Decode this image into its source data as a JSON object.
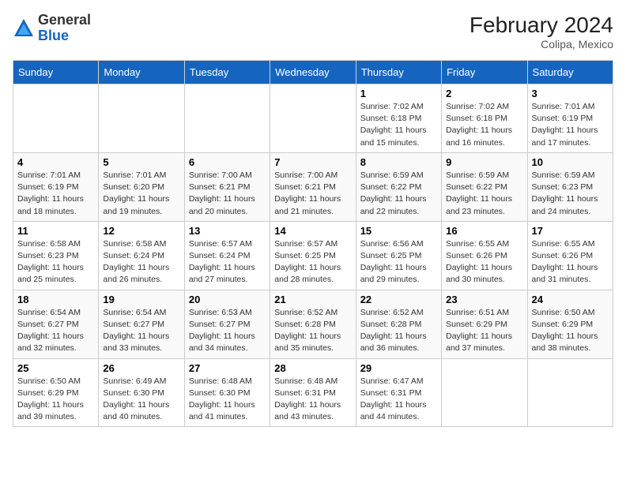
{
  "header": {
    "logo": {
      "general": "General",
      "blue": "Blue"
    },
    "title": "February 2024",
    "location": "Colipa, Mexico"
  },
  "weekdays": [
    "Sunday",
    "Monday",
    "Tuesday",
    "Wednesday",
    "Thursday",
    "Friday",
    "Saturday"
  ],
  "weeks": [
    [
      {
        "day": "",
        "info": ""
      },
      {
        "day": "",
        "info": ""
      },
      {
        "day": "",
        "info": ""
      },
      {
        "day": "",
        "info": ""
      },
      {
        "day": "1",
        "info": "Sunrise: 7:02 AM\nSunset: 6:18 PM\nDaylight: 11 hours and 15 minutes."
      },
      {
        "day": "2",
        "info": "Sunrise: 7:02 AM\nSunset: 6:18 PM\nDaylight: 11 hours and 16 minutes."
      },
      {
        "day": "3",
        "info": "Sunrise: 7:01 AM\nSunset: 6:19 PM\nDaylight: 11 hours and 17 minutes."
      }
    ],
    [
      {
        "day": "4",
        "info": "Sunrise: 7:01 AM\nSunset: 6:19 PM\nDaylight: 11 hours and 18 minutes."
      },
      {
        "day": "5",
        "info": "Sunrise: 7:01 AM\nSunset: 6:20 PM\nDaylight: 11 hours and 19 minutes."
      },
      {
        "day": "6",
        "info": "Sunrise: 7:00 AM\nSunset: 6:21 PM\nDaylight: 11 hours and 20 minutes."
      },
      {
        "day": "7",
        "info": "Sunrise: 7:00 AM\nSunset: 6:21 PM\nDaylight: 11 hours and 21 minutes."
      },
      {
        "day": "8",
        "info": "Sunrise: 6:59 AM\nSunset: 6:22 PM\nDaylight: 11 hours and 22 minutes."
      },
      {
        "day": "9",
        "info": "Sunrise: 6:59 AM\nSunset: 6:22 PM\nDaylight: 11 hours and 23 minutes."
      },
      {
        "day": "10",
        "info": "Sunrise: 6:59 AM\nSunset: 6:23 PM\nDaylight: 11 hours and 24 minutes."
      }
    ],
    [
      {
        "day": "11",
        "info": "Sunrise: 6:58 AM\nSunset: 6:23 PM\nDaylight: 11 hours and 25 minutes."
      },
      {
        "day": "12",
        "info": "Sunrise: 6:58 AM\nSunset: 6:24 PM\nDaylight: 11 hours and 26 minutes."
      },
      {
        "day": "13",
        "info": "Sunrise: 6:57 AM\nSunset: 6:24 PM\nDaylight: 11 hours and 27 minutes."
      },
      {
        "day": "14",
        "info": "Sunrise: 6:57 AM\nSunset: 6:25 PM\nDaylight: 11 hours and 28 minutes."
      },
      {
        "day": "15",
        "info": "Sunrise: 6:56 AM\nSunset: 6:25 PM\nDaylight: 11 hours and 29 minutes."
      },
      {
        "day": "16",
        "info": "Sunrise: 6:55 AM\nSunset: 6:26 PM\nDaylight: 11 hours and 30 minutes."
      },
      {
        "day": "17",
        "info": "Sunrise: 6:55 AM\nSunset: 6:26 PM\nDaylight: 11 hours and 31 minutes."
      }
    ],
    [
      {
        "day": "18",
        "info": "Sunrise: 6:54 AM\nSunset: 6:27 PM\nDaylight: 11 hours and 32 minutes."
      },
      {
        "day": "19",
        "info": "Sunrise: 6:54 AM\nSunset: 6:27 PM\nDaylight: 11 hours and 33 minutes."
      },
      {
        "day": "20",
        "info": "Sunrise: 6:53 AM\nSunset: 6:27 PM\nDaylight: 11 hours and 34 minutes."
      },
      {
        "day": "21",
        "info": "Sunrise: 6:52 AM\nSunset: 6:28 PM\nDaylight: 11 hours and 35 minutes."
      },
      {
        "day": "22",
        "info": "Sunrise: 6:52 AM\nSunset: 6:28 PM\nDaylight: 11 hours and 36 minutes."
      },
      {
        "day": "23",
        "info": "Sunrise: 6:51 AM\nSunset: 6:29 PM\nDaylight: 11 hours and 37 minutes."
      },
      {
        "day": "24",
        "info": "Sunrise: 6:50 AM\nSunset: 6:29 PM\nDaylight: 11 hours and 38 minutes."
      }
    ],
    [
      {
        "day": "25",
        "info": "Sunrise: 6:50 AM\nSunset: 6:29 PM\nDaylight: 11 hours and 39 minutes."
      },
      {
        "day": "26",
        "info": "Sunrise: 6:49 AM\nSunset: 6:30 PM\nDaylight: 11 hours and 40 minutes."
      },
      {
        "day": "27",
        "info": "Sunrise: 6:48 AM\nSunset: 6:30 PM\nDaylight: 11 hours and 41 minutes."
      },
      {
        "day": "28",
        "info": "Sunrise: 6:48 AM\nSunset: 6:31 PM\nDaylight: 11 hours and 43 minutes."
      },
      {
        "day": "29",
        "info": "Sunrise: 6:47 AM\nSunset: 6:31 PM\nDaylight: 11 hours and 44 minutes."
      },
      {
        "day": "",
        "info": ""
      },
      {
        "day": "",
        "info": ""
      }
    ]
  ]
}
